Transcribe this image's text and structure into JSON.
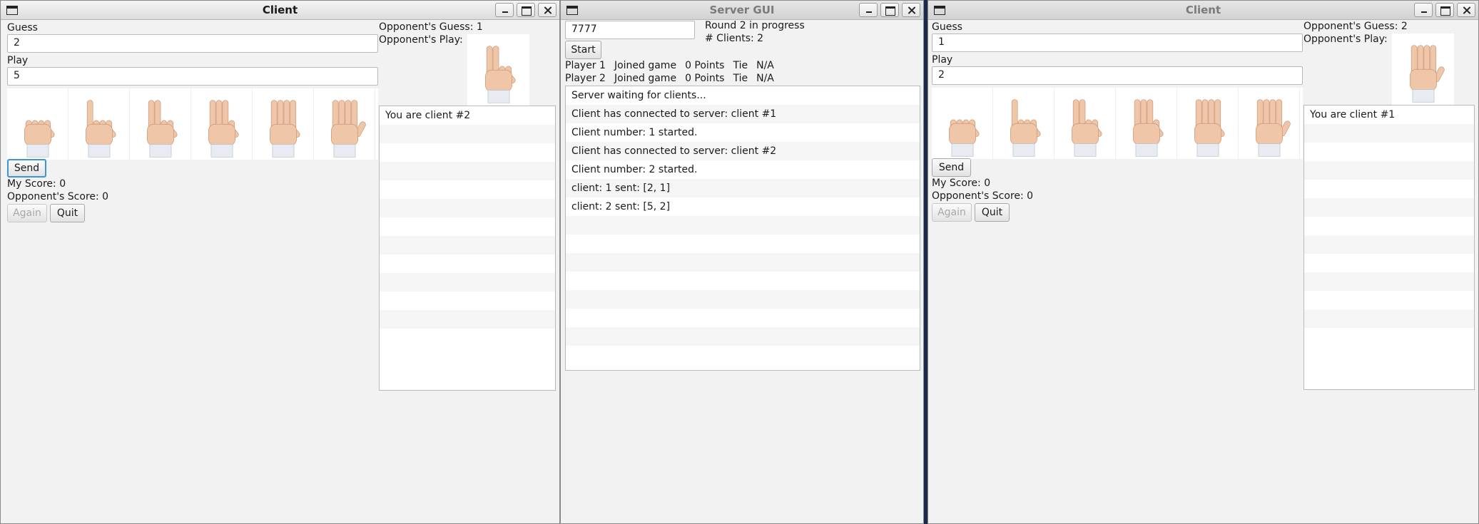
{
  "client_left": {
    "title": "Client",
    "guess_label": "Guess",
    "guess_value": "2",
    "play_label": "Play",
    "play_value": "5",
    "send_label": "Send",
    "my_score": "My Score: 0",
    "opp_score": "Opponent's Score: 0",
    "again_label": "Again",
    "quit_label": "Quit",
    "opp_guess": "Opponent's Guess: 1",
    "opp_play_label": "Opponent's Play:",
    "opp_play_icon": "two-fingers",
    "messages": [
      "You are client #2",
      "",
      "",
      "",
      "",
      "",
      "",
      "",
      "",
      "",
      "",
      ""
    ],
    "hand_icons": [
      "fist",
      "one-finger",
      "two-fingers",
      "three-fingers",
      "four-fingers",
      "five-fingers"
    ]
  },
  "server": {
    "title": "Server GUI",
    "port_value": "7777",
    "start_label": "Start",
    "round_status": "Round 2 in progress",
    "clients_count": "# Clients: 2",
    "players": [
      {
        "name": "Player 1",
        "status": "Joined game",
        "points": "0 Points",
        "result": "Tie",
        "extra": "N/A"
      },
      {
        "name": "Player 2",
        "status": "Joined game",
        "points": "0 Points",
        "result": "Tie",
        "extra": "N/A"
      }
    ],
    "log": [
      "Server waiting for clients...",
      "Client has connected to server: client #1",
      "Client number: 1 started.",
      "Client has connected to server: client #2",
      "Client number: 2 started.",
      "client: 1 sent: [2, 1]",
      "client: 2 sent: [5, 2]",
      "",
      "",
      "",
      "",
      "",
      "",
      "",
      ""
    ]
  },
  "client_right": {
    "title": "Client",
    "guess_label": "Guess",
    "guess_value": "1",
    "play_label": "Play",
    "play_value": "2",
    "send_label": "Send",
    "my_score": "My Score: 0",
    "opp_score": "Opponent's Score: 0",
    "again_label": "Again",
    "quit_label": "Quit",
    "opp_guess": "Opponent's Guess: 2",
    "opp_play_label": "Opponent's Play:",
    "opp_play_icon": "five-fingers",
    "messages": [
      "You are client #1",
      "",
      "",
      "",
      "",
      "",
      "",
      "",
      "",
      "",
      "",
      ""
    ],
    "hand_icons": [
      "fist",
      "one-finger",
      "two-fingers",
      "three-fingers",
      "four-fingers",
      "five-fingers"
    ]
  },
  "colors": {
    "window_bg": "#f2f2f2",
    "focus_ring": "#3a96d4",
    "skin": "#f0c6a8",
    "sleeve": "#e8ecf2"
  }
}
